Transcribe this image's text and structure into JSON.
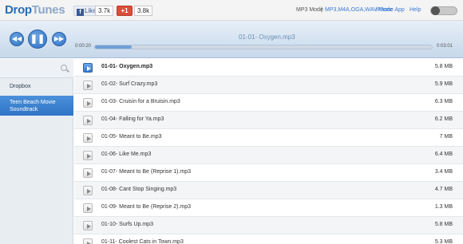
{
  "header": {
    "logo_drop": "Drop",
    "logo_tunes": "Tunes",
    "fb_like_label": "Like",
    "fb_like_count": "3.7k",
    "gplus_label": "+1",
    "gplus_count": "3.8k",
    "mode_label": "MP3 Mode",
    "mode_separator": "|",
    "alt_mode_link": "MP3,M4A,OGA,WAV Mode",
    "iphone_link": "iPhone App",
    "help_link": "Help",
    "toggle_on": false
  },
  "player": {
    "current_title": "01-01- Oxygen.mp3",
    "elapsed": "0:00:20",
    "duration": "0:03:01",
    "progress_fraction": 0.11,
    "prev_icon": "rewind-icon",
    "play_pause_icon": "pause-icon",
    "next_icon": "fast-forward-icon"
  },
  "sidebar": {
    "search_icon": "search-icon",
    "items": [
      {
        "label": "Dropbox",
        "active": false
      },
      {
        "label": "Teen Beach Movie Soundtrack",
        "active": true
      }
    ]
  },
  "tracks": [
    {
      "name": "01-01- Oxygen.mp3",
      "size": "5.8 MB",
      "current": true
    },
    {
      "name": "01-02- Surf Crazy.mp3",
      "size": "5.9 MB",
      "current": false
    },
    {
      "name": "01-03- Cruisin for a Bruisin.mp3",
      "size": "6.3 MB",
      "current": false
    },
    {
      "name": "01-04- Falling for Ya.mp3",
      "size": "6.2 MB",
      "current": false
    },
    {
      "name": "01-05- Meant to Be.mp3",
      "size": "7 MB",
      "current": false
    },
    {
      "name": "01-06- Like Me.mp3",
      "size": "6.4 MB",
      "current": false
    },
    {
      "name": "01-07- Meant to Be (Reprise 1).mp3",
      "size": "3.4 MB",
      "current": false
    },
    {
      "name": "01-08- Cant Stop Singing.mp3",
      "size": "4.7 MB",
      "current": false
    },
    {
      "name": "01-09- Meant to Be (Reprise 2).mp3",
      "size": "1.3 MB",
      "current": false
    },
    {
      "name": "01-10- Surfs Up.mp3",
      "size": "5.8 MB",
      "current": false
    },
    {
      "name": "01-11- Coolest Cats in Town.mp3",
      "size": "5.3 MB",
      "current": false
    }
  ],
  "colors": {
    "accent": "#2f6fc1",
    "sidebar_active": "#3a7fcf"
  }
}
